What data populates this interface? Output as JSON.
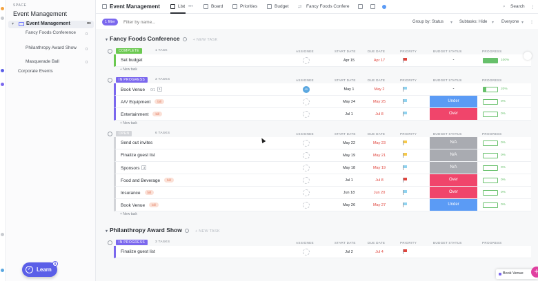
{
  "sidebar": {
    "space_label": "SPACE",
    "space_title": "Event Management",
    "folder": {
      "name": "Event Management"
    },
    "lists": [
      {
        "name": "Fancy Foods Conference",
        "count": "0"
      },
      {
        "name": "Philanthropy Award Show",
        "count": "0"
      },
      {
        "name": "Masquerade Ball",
        "count": "0"
      }
    ],
    "other_folder": "Corporate Events",
    "learn": {
      "label": "Learn",
      "badge": "8"
    }
  },
  "topbar": {
    "title": "Event Management",
    "tabs": [
      "List",
      "Board",
      "Priorities",
      "Budget",
      "Fancy Foods Confere"
    ],
    "search": "Search"
  },
  "filterbar": {
    "filter_chip": "1 filter",
    "filter_placeholder": "Filter by name...",
    "group_by": "Group by: Status",
    "subtasks": "Subtasks: Hide",
    "everyone": "Everyone"
  },
  "columns": {
    "assignee": "ASSIGNEE",
    "start": "START DATE",
    "due": "DUE DATE",
    "priority": "PRIORITY",
    "budget": "BUDGET STATUS",
    "progress": "PROGRESS"
  },
  "new_task_label": "+ NEW TASK",
  "add_task_label": "+ New task",
  "groups": [
    {
      "title": "Fancy Foods Conference",
      "statuses": [
        {
          "label": "COMPLETE",
          "count": "1 TASK",
          "color": "#6bc950",
          "tasks": [
            {
              "name": "Set budget",
              "start": "Apr 15",
              "due": "Apr 17",
              "priority": "#e0443c",
              "budget": "-",
              "budget_color": "",
              "progress": 100,
              "progress_label": "100%"
            }
          ]
        },
        {
          "label": "IN PROGRESS",
          "count": "3 TASKS",
          "color": "#7b68ee",
          "tasks": [
            {
              "name": "Book Venue",
              "subtasks": "0/1",
              "sub_box": "1",
              "assignee": "JD",
              "start": "May 1",
              "due": "May 2",
              "priority": "#8fd3f0",
              "budget": "-",
              "budget_color": "",
              "progress": 20,
              "progress_label": "20%"
            },
            {
              "name": "A/V Equipment",
              "tag": "bill",
              "start": "May 24",
              "due": "May 25",
              "priority": "#8fd3f0",
              "budget": "Under",
              "budget_color": "#5b9bf5",
              "progress": 0,
              "progress_label": "0%"
            },
            {
              "name": "Entertainment",
              "tag": "bill",
              "start": "Jul 1",
              "due": "Jul 8",
              "priority": "#8fd3f0",
              "budget": "Over",
              "budget_color": "#f0456b",
              "progress": 0,
              "progress_label": "0%"
            }
          ]
        },
        {
          "label": "OPEN",
          "count": "6 TASKS",
          "color": "#d3d5d9",
          "tasks": [
            {
              "name": "Send out invites",
              "start": "May 22",
              "due": "May 23",
              "priority": "#f7c948",
              "budget": "N/A",
              "budget_color": "#a9abb1",
              "progress": 0,
              "progress_label": "0%"
            },
            {
              "name": "Finalize guest list",
              "start": "May 19",
              "due": "May 21",
              "priority": "#f7c948",
              "budget": "N/A",
              "budget_color": "#a9abb1",
              "progress": 0,
              "progress_label": "0%"
            },
            {
              "name": "Sponsors",
              "sub_box": "3",
              "start": "May 18",
              "due": "May 19",
              "priority": "#8fd3f0",
              "budget": "N/A",
              "budget_color": "#a9abb1",
              "progress": 0,
              "progress_label": "0%"
            },
            {
              "name": "Food and Beverage",
              "tag": "bill",
              "start": "Jul 1",
              "due": "Jul 8",
              "priority": "#e0443c",
              "budget": "Over",
              "budget_color": "#f0456b",
              "progress": 0,
              "progress_label": "0%"
            },
            {
              "name": "Insurance",
              "tag": "bill",
              "start": "Jun 18",
              "due": "Jun 20",
              "priority": "#8fd3f0",
              "budget": "Over",
              "budget_color": "#f0456b",
              "progress": 0,
              "progress_label": "0%"
            },
            {
              "name": "Book Venue",
              "tag": "bill",
              "start": "May 26",
              "due": "May 27",
              "priority": "#8fd3f0",
              "budget": "Under",
              "budget_color": "#5b9bf5",
              "progress": 0,
              "progress_label": "0%"
            }
          ]
        }
      ]
    },
    {
      "title": "Philanthropy Award Show",
      "statuses": [
        {
          "label": "IN PROGRESS",
          "count": "3 TASKS",
          "color": "#7b68ee",
          "tasks": [
            {
              "name": "Finalize guest list",
              "start": "Jul 2",
              "due": "Jul 4",
              "priority": "#e0443c",
              "budget": "",
              "budget_color": "",
              "progress": 0,
              "progress_label": ""
            }
          ]
        }
      ]
    }
  ],
  "toast": {
    "text": "Book Venue"
  }
}
